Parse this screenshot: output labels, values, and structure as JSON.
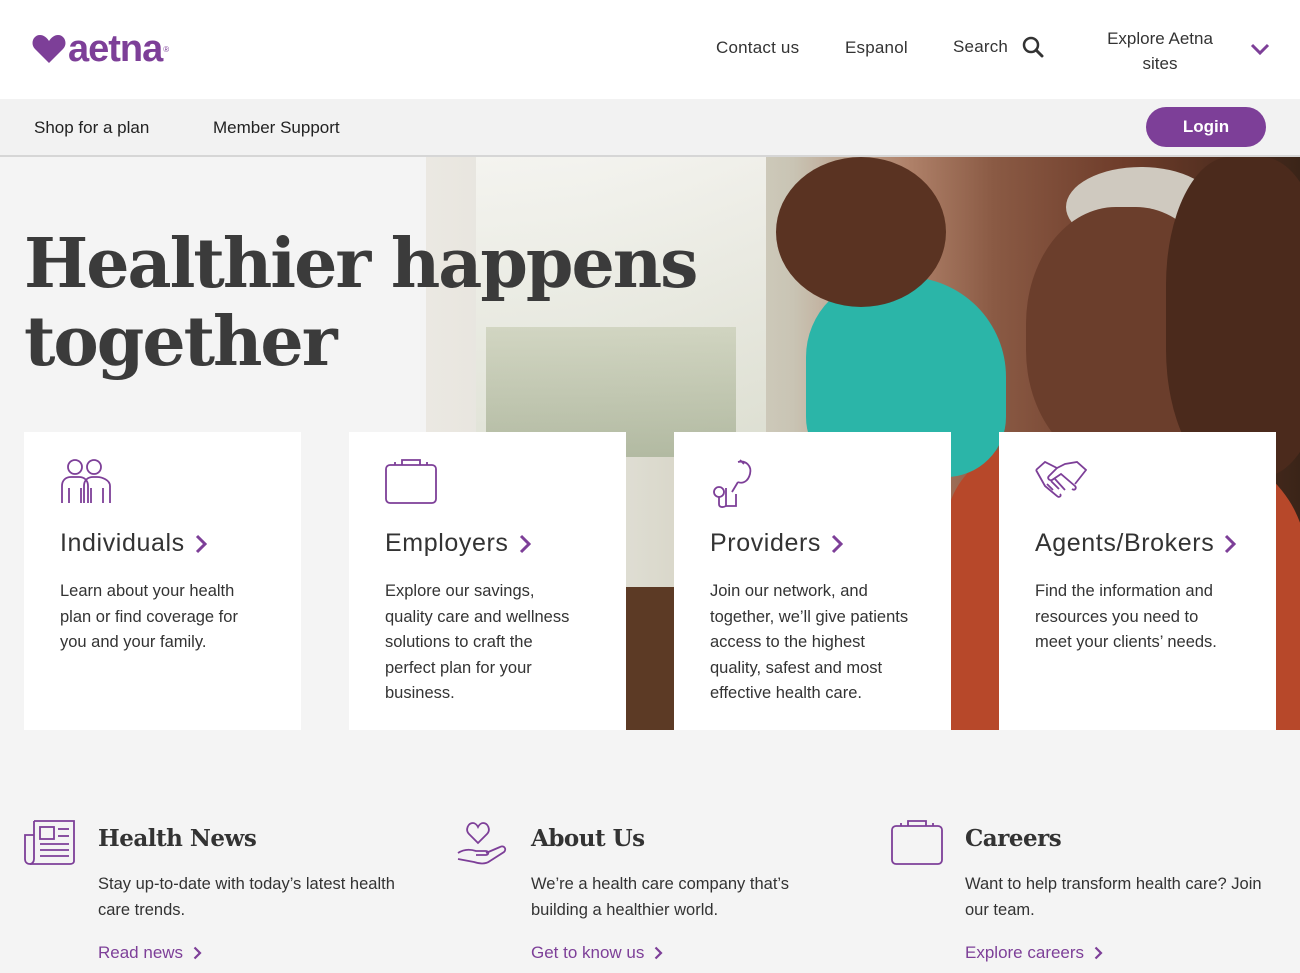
{
  "brand": {
    "logo_text": "aetna",
    "accent": "#7d3f98"
  },
  "header": {
    "contact": "Contact us",
    "espanol": "Espanol",
    "search": "Search",
    "explore": "Explore Aetna sites"
  },
  "subnav": {
    "shop": "Shop for a plan",
    "member": "Member Support",
    "login": "Login"
  },
  "hero": {
    "title_line1": "Healthier happens",
    "title_line2": "together"
  },
  "cards": [
    {
      "title": "Individuals",
      "desc": "Learn about your health plan or find coverage for you and your family.",
      "icon": "people-icon"
    },
    {
      "title": "Employers",
      "desc": "Explore our savings, quality care and wellness solutions to craft the perfect plan for your business.",
      "icon": "briefcase-icon"
    },
    {
      "title": "Providers",
      "desc": "Join our network, and together, we’ll give patients access to the highest quality, safest and most effective health care.",
      "icon": "stethoscope-icon"
    },
    {
      "title": "Agents/Brokers",
      "desc": "Find the information and resources you need to meet your clients’ needs.",
      "icon": "handshake-icon"
    }
  ],
  "features": [
    {
      "title": "Health News",
      "desc": "Stay up-to-date with today’s latest health care trends.",
      "link": "Read news",
      "icon": "newspaper-icon"
    },
    {
      "title": "About Us",
      "desc": "We’re a health care company that’s building a healthier world.",
      "link": "Get to know us",
      "icon": "heart-hand-icon"
    },
    {
      "title": "Careers",
      "desc": "Want to help transform health care? Join our team.",
      "link": "Explore careers",
      "icon": "briefcase-icon"
    }
  ]
}
